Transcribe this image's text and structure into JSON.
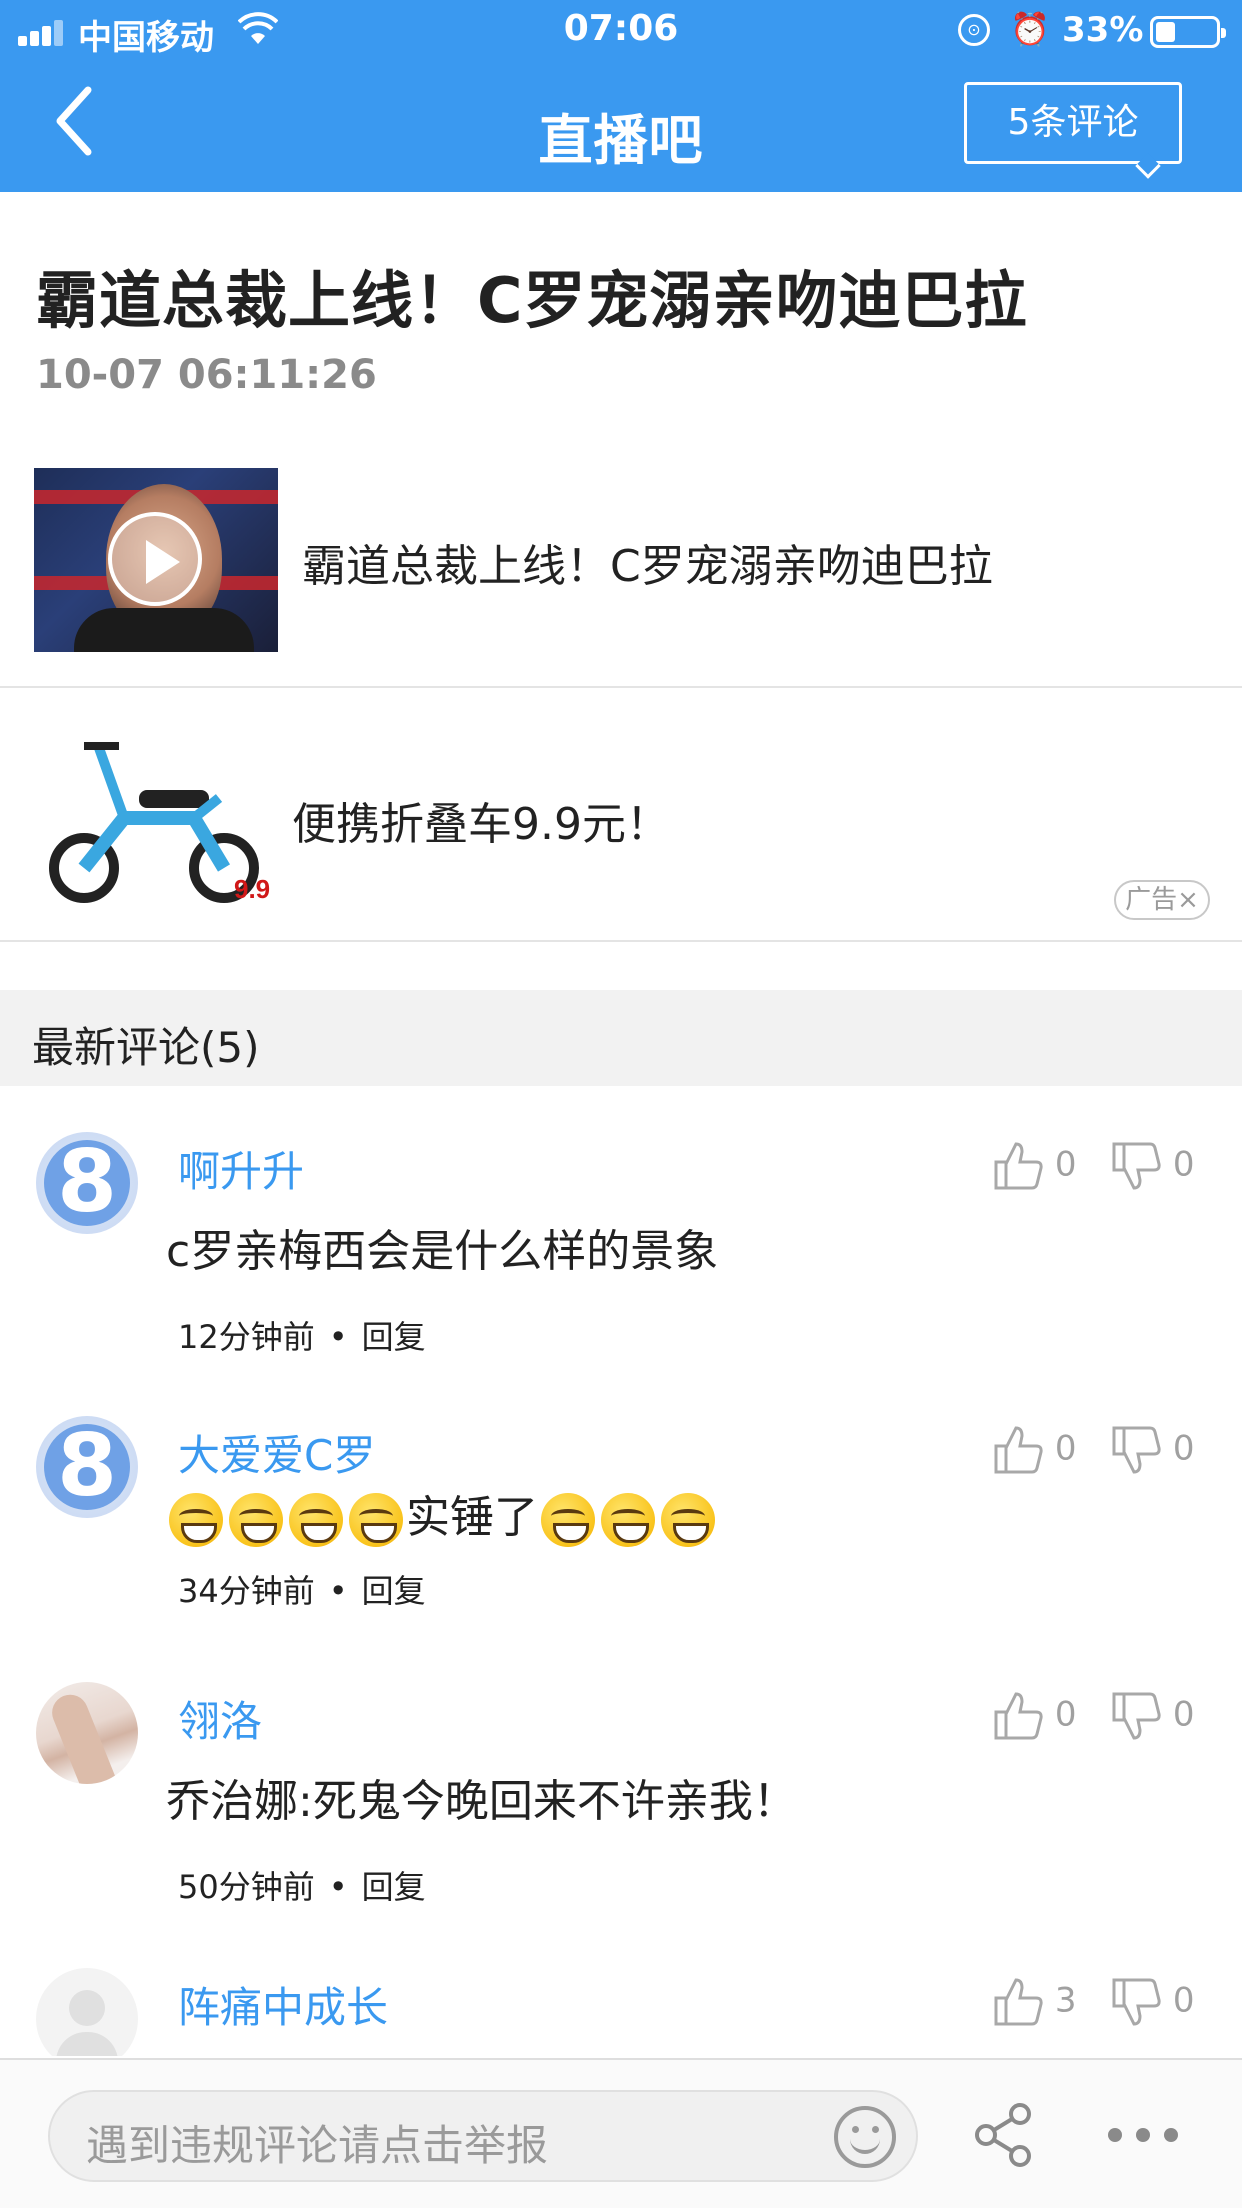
{
  "status_bar": {
    "carrier": "中国移动",
    "time": "07:06",
    "battery": "33%",
    "battery_level": 0.33,
    "icons": [
      "signal-icon",
      "wifi-icon",
      "rotation-lock-icon",
      "alarm-icon",
      "battery-icon"
    ]
  },
  "nav": {
    "title": "直播吧",
    "comments_button": "5条评论",
    "back_icon": "chevron-left-icon"
  },
  "article": {
    "title": "霸道总裁上线！C罗宠溺亲吻迪巴拉",
    "time": "10-07 06:11:26"
  },
  "video": {
    "title": "霸道总裁上线！C罗宠溺亲吻迪巴拉",
    "play_icon": "play-icon"
  },
  "ad": {
    "text": "便携折叠车9.9元！",
    "badge": "广告×"
  },
  "comments_section": {
    "header": "最新评论(5)",
    "reply_label": "回复",
    "items": [
      {
        "user": "啊升升",
        "text": "c罗亲梅西会是什么样的景象",
        "time": "12分钟前",
        "likes": "0",
        "dislikes": "0"
      },
      {
        "user": "大爱爱C罗",
        "text_before": "",
        "text_middle": "实锤了",
        "emoji_before": 4,
        "emoji_after": 3,
        "time": "34分钟前",
        "likes": "0",
        "dislikes": "0"
      },
      {
        "user": "翎洛",
        "text": "乔治娜:死鬼今晚回来不许亲我！",
        "time": "50分钟前",
        "likes": "0",
        "dislikes": "0"
      },
      {
        "user": "阵痛中成长",
        "text": "",
        "time": "",
        "likes": "3",
        "dislikes": "0"
      }
    ]
  },
  "bottom_bar": {
    "placeholder": "遇到违规评论请点击举报",
    "icons": [
      "smile-icon",
      "share-icon",
      "more-icon"
    ]
  },
  "colors": {
    "brand_blue": "#3a99f0",
    "username_blue": "#3a99f0",
    "muted_gray": "#8a8a8a"
  }
}
